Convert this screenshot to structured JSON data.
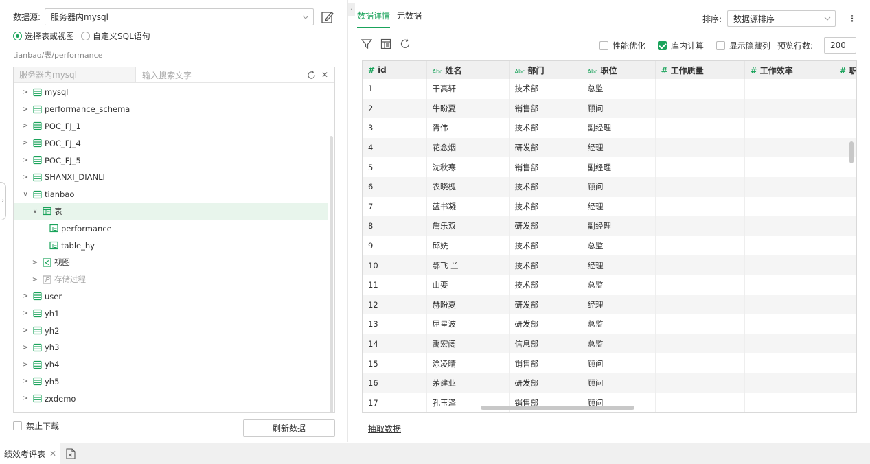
{
  "datasource": {
    "label": "数据源:",
    "value": "服务器内mysql"
  },
  "modes": [
    {
      "label": "选择表或视图",
      "selected": true
    },
    {
      "label": "自定义SQL语句",
      "selected": false
    }
  ],
  "path": "tianbao/表/performance",
  "tree": {
    "source": "服务器内mysql",
    "search_placeholder": "输入搜索文字",
    "items": [
      {
        "label": "mysql",
        "level": 0,
        "chev": ">",
        "icon": "database-icon"
      },
      {
        "label": "performance_schema",
        "level": 0,
        "chev": ">",
        "icon": "database-icon"
      },
      {
        "label": "POC_FJ_1",
        "level": 0,
        "chev": ">",
        "icon": "database-icon"
      },
      {
        "label": "POC_FJ_4",
        "level": 0,
        "chev": ">",
        "icon": "database-icon"
      },
      {
        "label": "POC_FJ_5",
        "level": 0,
        "chev": ">",
        "icon": "database-icon"
      },
      {
        "label": "SHANXI_DIANLI",
        "level": 0,
        "chev": ">",
        "icon": "database-icon"
      },
      {
        "label": "tianbao",
        "level": 0,
        "chev": "v",
        "icon": "database-icon"
      },
      {
        "label": "表",
        "level": 1,
        "chev": "v",
        "icon": "table-icon",
        "selected": true
      },
      {
        "label": "performance",
        "level": 2,
        "chev": "",
        "icon": "table-icon"
      },
      {
        "label": "table_hy",
        "level": 2,
        "chev": "",
        "icon": "table-icon"
      },
      {
        "label": "视图",
        "level": 1,
        "chev": ">",
        "icon": "view-icon"
      },
      {
        "label": "存储过程",
        "level": 1,
        "chev": ">",
        "icon": "procedure-icon",
        "disabled": true
      },
      {
        "label": "user",
        "level": 0,
        "chev": ">",
        "icon": "database-icon"
      },
      {
        "label": "yh1",
        "level": 0,
        "chev": ">",
        "icon": "database-icon"
      },
      {
        "label": "yh2",
        "level": 0,
        "chev": ">",
        "icon": "database-icon"
      },
      {
        "label": "yh3",
        "level": 0,
        "chev": ">",
        "icon": "database-icon"
      },
      {
        "label": "yh4",
        "level": 0,
        "chev": ">",
        "icon": "database-icon"
      },
      {
        "label": "yh5",
        "level": 0,
        "chev": ">",
        "icon": "database-icon"
      },
      {
        "label": "zxdemo",
        "level": 0,
        "chev": ">",
        "icon": "database-icon"
      }
    ]
  },
  "disable_download": "禁止下载",
  "refresh_button": "刷新数据",
  "tabs": [
    {
      "label": "数据详情",
      "active": true
    },
    {
      "label": "元数据",
      "active": false
    }
  ],
  "sort": {
    "label": "排序:",
    "value": "数据源排序"
  },
  "options": {
    "perf": "性能优化",
    "perf_checked": false,
    "inmem": "库内计算",
    "inmem_checked": true,
    "hidden_cols": "显示隐藏列",
    "hidden_checked": false,
    "preview_label": "预览行数:",
    "preview_value": "200"
  },
  "table": {
    "columns": [
      {
        "name": "id",
        "type": "#"
      },
      {
        "name": "姓名",
        "type": "Abc"
      },
      {
        "name": "部门",
        "type": "Abc"
      },
      {
        "name": "职位",
        "type": "Abc"
      },
      {
        "name": "工作质量",
        "type": "#"
      },
      {
        "name": "工作效率",
        "type": "#"
      },
      {
        "name": "职",
        "type": "#"
      }
    ],
    "rows": [
      [
        "1",
        "干高轩",
        "技术部",
        "总监"
      ],
      [
        "2",
        "牛盼夏",
        "销售部",
        "顾问"
      ],
      [
        "3",
        "胥伟",
        "技术部",
        "副经理"
      ],
      [
        "4",
        "花念烟",
        "研发部",
        "经理"
      ],
      [
        "5",
        "沈秋寒",
        "销售部",
        "副经理"
      ],
      [
        "6",
        "农晓槐",
        "技术部",
        "顾问"
      ],
      [
        "7",
        "蓝书凝",
        "技术部",
        "经理"
      ],
      [
        "8",
        "詹乐双",
        "研发部",
        "副经理"
      ],
      [
        "9",
        "邱姺",
        "技术部",
        "总监"
      ],
      [
        "10",
        "鄂飞 兰",
        "技术部",
        "经理"
      ],
      [
        "11",
        "山娈",
        "技术部",
        "总监"
      ],
      [
        "12",
        "赫盼夏",
        "研发部",
        "经理"
      ],
      [
        "13",
        "屈星波",
        "研发部",
        "总监"
      ],
      [
        "14",
        "禹宏阔",
        "信息部",
        "总监"
      ],
      [
        "15",
        "涂凌晴",
        "销售部",
        "顾问"
      ],
      [
        "16",
        "茅建业",
        "研发部",
        "顾问"
      ],
      [
        "17",
        "孔玉泽",
        "销售部",
        "顾问"
      ]
    ]
  },
  "extract_link": "抽取数据",
  "bottom_tab": {
    "label": "绩效考评表"
  },
  "colors": {
    "accent": "#1aa35b"
  }
}
